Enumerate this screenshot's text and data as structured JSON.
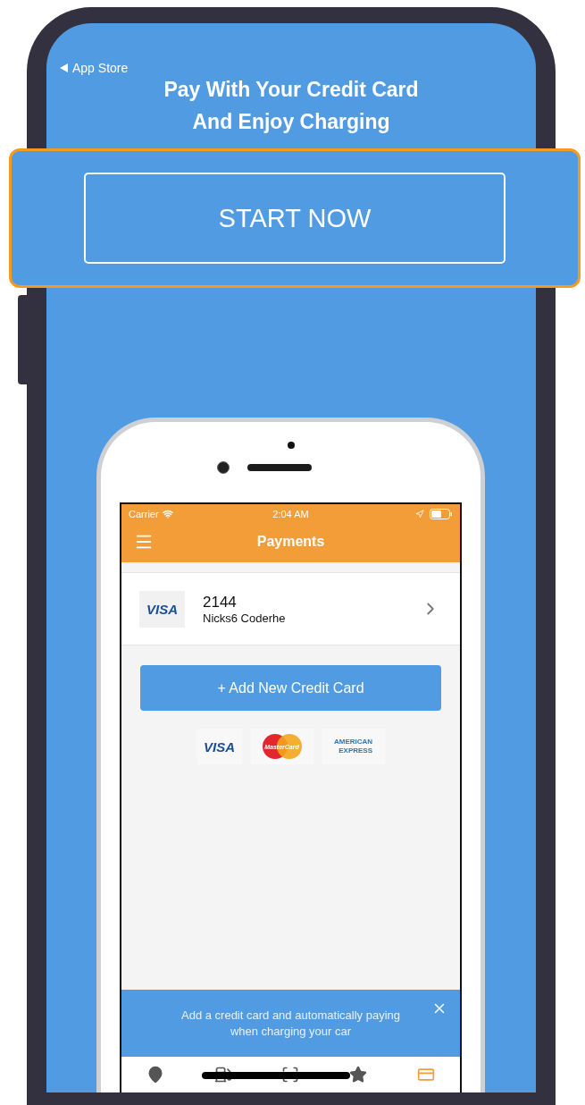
{
  "back_link": {
    "label": "App Store"
  },
  "headline": "Pay With Your Credit Card\nAnd Enjoy Charging",
  "start_button": {
    "label": "START NOW",
    "highlighted": true
  },
  "device": {
    "status_bar": {
      "carrier": "Carrier",
      "time": "2:04 AM"
    },
    "nav_title": "Payments",
    "cards": [
      {
        "logo": "VISA",
        "number": "2144",
        "holder": "Nicks6 Coderhe"
      }
    ],
    "add_button": "+ Add New Credit Card",
    "accepted_cards": [
      {
        "kind": "visa",
        "label": "VISA"
      },
      {
        "kind": "mastercard",
        "label": "MasterCard"
      },
      {
        "kind": "amex",
        "label": "AMERICAN\nEXPRESS"
      }
    ],
    "banner": {
      "text": "Add a credit card and automatically paying\nwhen charging your car"
    },
    "tabs": [
      {
        "kind": "location",
        "selected": false
      },
      {
        "kind": "charger",
        "selected": false
      },
      {
        "kind": "scan",
        "selected": false
      },
      {
        "kind": "favorites",
        "selected": false
      },
      {
        "kind": "payments",
        "selected": true
      }
    ]
  }
}
